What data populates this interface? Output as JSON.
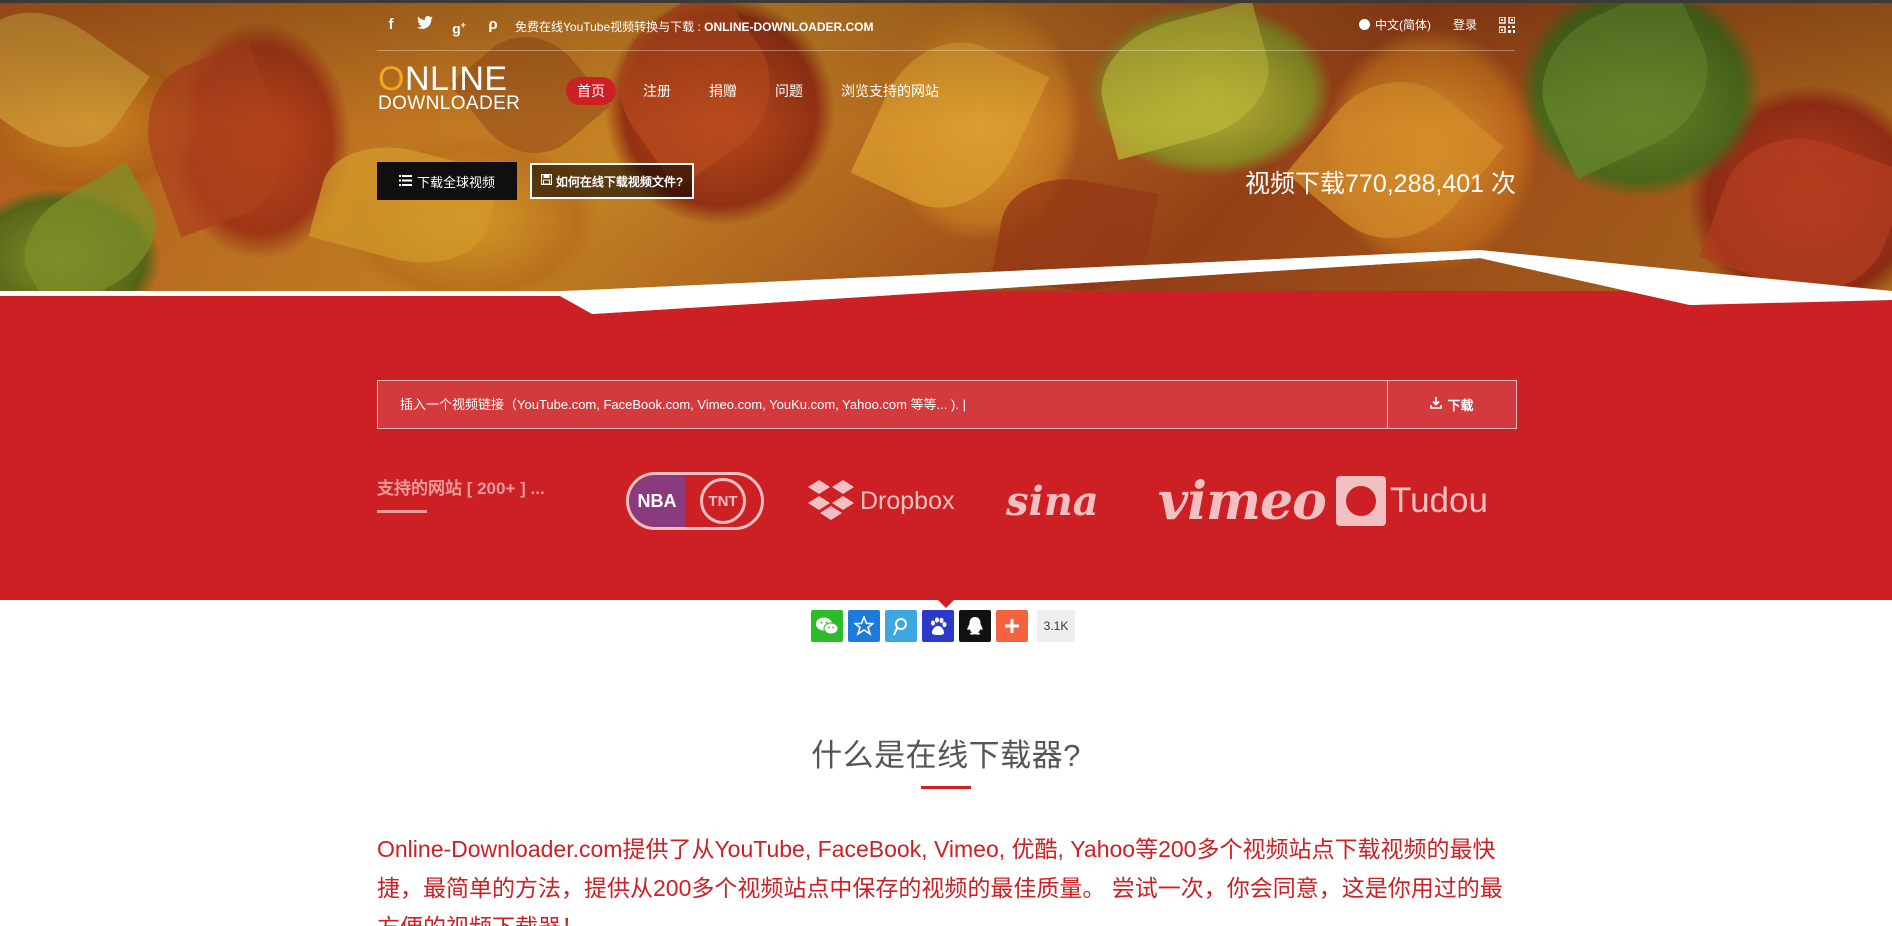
{
  "topbar": {
    "social_icons": [
      "facebook-icon",
      "twitter-icon",
      "google-plus-icon",
      "pinterest-icon"
    ],
    "tagline_prefix": "免费在线YouTube视频转换与下载 : ",
    "tagline_site": "ONLINE-DOWNLOADER.COM",
    "language": "中文(简体)",
    "login": "登录"
  },
  "logo": {
    "first_letter": "O",
    "line1_rest": "NLINE",
    "line2": "DOWNLOADER"
  },
  "nav": {
    "items": [
      {
        "label": "首页",
        "active": true
      },
      {
        "label": "注册"
      },
      {
        "label": "捐赠"
      },
      {
        "label": "问题"
      },
      {
        "label": "浏览支持的网站"
      }
    ]
  },
  "hero": {
    "download_global_label": "下载全球视频",
    "how_to_label": "如何在线下载视频文件?",
    "counter_text": "视频下载770,288,401 次"
  },
  "search": {
    "placeholder": "插入一个视频链接（YouTube.com, FaceBook.com, Vimeo.com, YouKu.com, Yahoo.com 等等... ). |",
    "button_label": "下载"
  },
  "supported": {
    "label": "支持的网站 [ 200+ ] ...",
    "sites": {
      "nba_left": "NBA",
      "nba_right": "TNT",
      "dropbox": "Dropbox",
      "sina": "sina",
      "vimeo": "vimeo",
      "tudou": "Tudou"
    }
  },
  "share": {
    "buttons": [
      {
        "name": "wechat-icon",
        "color": "#2dbb29",
        "glyph": "☺"
      },
      {
        "name": "qzone-icon",
        "color": "#1c7ad9",
        "glyph": "★"
      },
      {
        "name": "tencent-weibo-icon",
        "color": "#3ea6e1",
        "glyph": "P"
      },
      {
        "name": "baidu-icon",
        "color": "#2b3ac9",
        "glyph": "❀"
      },
      {
        "name": "qq-icon",
        "color": "#111111",
        "glyph": "♟"
      },
      {
        "name": "more-share-icon",
        "color": "#f4623f",
        "glyph": "+"
      }
    ],
    "count": "3.1K"
  },
  "about": {
    "title": "什么是在线下载器?",
    "text": "Online-Downloader.com提供了从YouTube, FaceBook, Vimeo, 优酷, Yahoo等200多个视频站点下载视频的最快捷，最简单的方法，提供从200多个视频站点中保存的视频的最佳质量。 尝试一次，你会同意，这是你用过的最方便的视频下载器！"
  },
  "colors": {
    "brand_red": "#cc2024",
    "logo_orange": "#f5a623"
  }
}
